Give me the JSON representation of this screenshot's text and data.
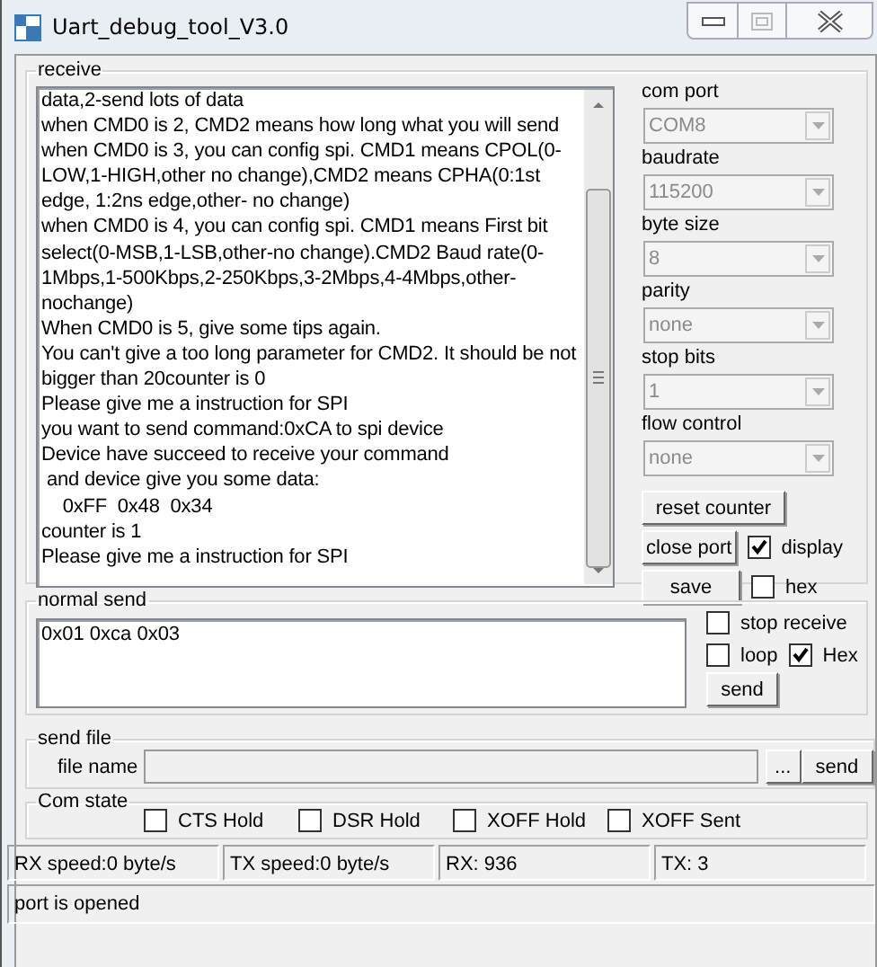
{
  "window": {
    "title": "Uart_debug_tool_V3.0"
  },
  "receive": {
    "label": "receive",
    "lines": [
      "data,2-send lots of data",
      "when CMD0 is 2, CMD2 means how long what you will send",
      "when CMD0 is 3, you can config spi. CMD1 means CPOL(0-",
      "LOW,1-HIGH,other no change),CMD2 means CPHA(0:1st",
      "edge, 1:2ns edge,other- no change)",
      "when CMD0 is 4, you can config spi. CMD1 means First bit",
      "select(0-MSB,1-LSB,other-no change).CMD2 Baud rate(0-",
      "1Mbps,1-500Kbps,2-250Kbps,3-2Mbps,4-4Mbps,other-",
      "nochange)",
      "When CMD0 is 5, give some tips again.",
      "You can't give a too long parameter for CMD2. It should be not",
      "bigger than 20counter is 0",
      "Please give me a instruction for SPI",
      "you want to send command:0xCA to spi device",
      "Device have succeed to receive your command",
      " and device give you some data:",
      "    0xFF  0x48  0x34",
      "counter is 1",
      "Please give me a instruction for SPI"
    ]
  },
  "settings": [
    {
      "label": "com port",
      "value": "COM8",
      "disabled": true
    },
    {
      "label": "baudrate",
      "value": "115200",
      "disabled": true
    },
    {
      "label": "byte size",
      "value": "8",
      "disabled": true
    },
    {
      "label": "parity",
      "value": "none",
      "disabled": true
    },
    {
      "label": "stop bits",
      "value": "1",
      "disabled": true
    },
    {
      "label": "flow control",
      "value": "none",
      "disabled": true
    }
  ],
  "reset_button": "reset counter",
  "close_port_button": "close port",
  "display_checkbox": {
    "label": "display",
    "checked": true
  },
  "save_button": "save",
  "hex_checkbox": {
    "label": "hex",
    "checked": false
  },
  "normal_send": {
    "label": "normal send",
    "value": "0x01 0xca 0x03",
    "stop_receive": {
      "label": "stop receive",
      "checked": false
    },
    "loop": {
      "label": "loop",
      "checked": false
    },
    "hex": {
      "label": "Hex",
      "checked": true
    },
    "send_button": "send"
  },
  "send_file": {
    "label": "send file",
    "file_label": "file name",
    "browse_button": "...",
    "send_button": "send"
  },
  "com_state": {
    "label": "Com state",
    "items": [
      {
        "label": "CTS Hold",
        "checked": false
      },
      {
        "label": "DSR Hold",
        "checked": false
      },
      {
        "label": "XOFF Hold",
        "checked": false
      },
      {
        "label": "XOFF Sent",
        "checked": false
      }
    ]
  },
  "status_bar": {
    "panels": [
      "RX speed:0 byte/s",
      "TX speed:0 byte/s",
      "RX: 936",
      "TX: 3"
    ],
    "message": "port is opened"
  }
}
